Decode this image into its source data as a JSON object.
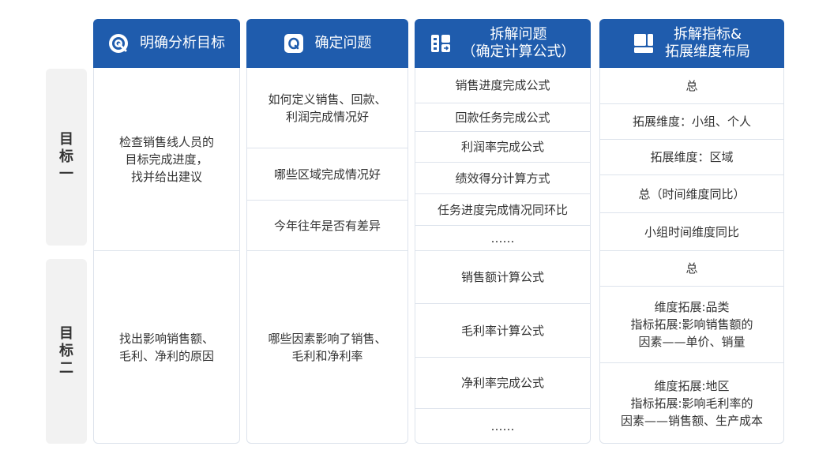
{
  "headers": [
    {
      "icon": "target-icon",
      "title": "明确分析目标"
    },
    {
      "icon": "question-icon",
      "title": "确定问题"
    },
    {
      "icon": "split-icon",
      "title": "拆解问题",
      "subtitle": "（确定计算公式）"
    },
    {
      "icon": "layout-icon",
      "title": "拆解指标&",
      "subtitle": "拓展维度布局"
    }
  ],
  "goals": [
    "目标一",
    "目标二"
  ],
  "goal1": {
    "objective": "检查销售线人员的\n目标完成进度，\n找并给出建议",
    "questions": [
      "如何定义销售、回款、\n利润完成情况好",
      "哪些区域完成情况好",
      "今年往年是否有差异"
    ],
    "formulas": [
      "销售进度完成公式",
      "回款任务完成公式",
      "利润率完成公式",
      "绩效得分计算方式",
      "任务进度完成情况同环比",
      "……"
    ],
    "dimensions": [
      "总",
      "拓展维度：小组、个人",
      "拓展维度：区域",
      "总（时间维度同比）",
      "小组时间维度同比"
    ]
  },
  "goal2": {
    "objective": "找出影响销售额、\n毛利、净利的原因",
    "question": "哪些因素影响了销售、\n毛利和净利率",
    "formulas": [
      "销售额计算公式",
      "毛利率计算公式",
      "净利率完成公式",
      "……"
    ],
    "dimensions": [
      "总",
      "维度拓展:品类\n指标拓展:影响销售额的\n因素——单价、销量",
      "维度拓展:地区\n指标拓展:影响毛利率的\n因素——销售额、生产成本"
    ]
  },
  "colors": {
    "header": "#1f5cad",
    "border": "#dde3ec",
    "goal_bg": "#f2f2f2"
  }
}
